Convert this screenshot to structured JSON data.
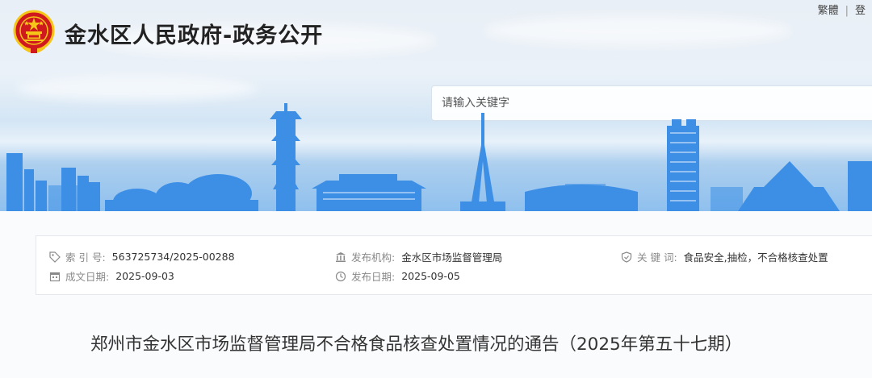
{
  "header": {
    "site_title": "金水区人民政府-政务公开",
    "links": {
      "traditional": "繁體",
      "login": "登"
    },
    "search": {
      "placeholder": "请输入关键字"
    }
  },
  "meta": {
    "index_no": {
      "label": "索 引 号:",
      "value": "563725734/2025-00288"
    },
    "publisher": {
      "label": "发布机构:",
      "value": "金水区市场监督管理局"
    },
    "keywords": {
      "label": "关 键 词:",
      "value": "食品安全,抽检，不合格核查处置"
    },
    "created_date": {
      "label": "成文日期:",
      "value": "2025-09-03"
    },
    "publish_date": {
      "label": "发布日期:",
      "value": "2025-09-05"
    }
  },
  "article": {
    "title": "郑州市金水区市场监督管理局不合格食品核查处置情况的通告（2025年第五十七期）"
  },
  "colors": {
    "skyline_blue": "#3d8fe6",
    "emblem_red": "#d0191f",
    "emblem_gold": "#f5c518",
    "icon_gray": "#8a8a8a"
  },
  "icons": [
    "national-emblem-icon",
    "tag-icon",
    "bank-icon",
    "shield-check-icon",
    "calendar-icon",
    "clock-icon"
  ]
}
